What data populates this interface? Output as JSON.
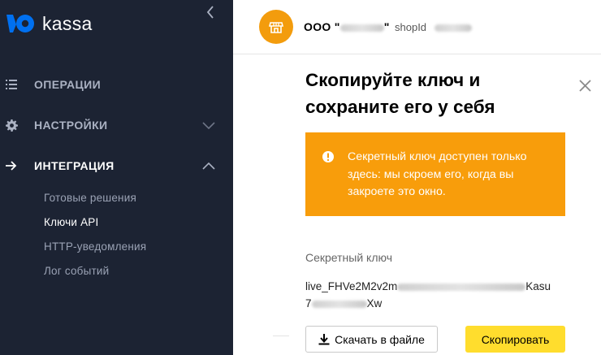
{
  "sidebar": {
    "logo_text": "kassa",
    "nav": [
      {
        "label": "ОПЕРАЦИИ",
        "icon": "list-icon"
      },
      {
        "label": "НАСТРОЙКИ",
        "icon": "gear-icon"
      },
      {
        "label": "ИНТЕГРАЦИЯ",
        "icon": "arrow-right-icon"
      }
    ],
    "subnav": [
      {
        "label": "Готовые решения"
      },
      {
        "label": "Ключи API"
      },
      {
        "label": "HTTP-уведомления"
      },
      {
        "label": "Лог событий"
      }
    ],
    "active_subnav": "Ключи API"
  },
  "header": {
    "shop_prefix": "ООО \"",
    "shop_suffix": "\"",
    "shop_id_label": "shopId"
  },
  "modal": {
    "title": "Скопируйте ключ и сохраните его у себя",
    "warning_text": "Секретный ключ доступен только здесь: мы скроем его, когда вы закроете это окно.",
    "key_label": "Секретный ключ",
    "key_start": "live_FHVe2M2v2m",
    "key_mid": "Kasu",
    "key_line2_start": "7",
    "key_line2_end": "Xw",
    "download_label": "Скачать в файле",
    "copy_label": "Скопировать"
  },
  "colors": {
    "sidebar_bg": "#1c2333",
    "brand_blue": "#0070f0",
    "shop_avatar": "#f39c0d",
    "warning_bg": "#f89d0b",
    "copy_button": "#ffdd2d"
  }
}
